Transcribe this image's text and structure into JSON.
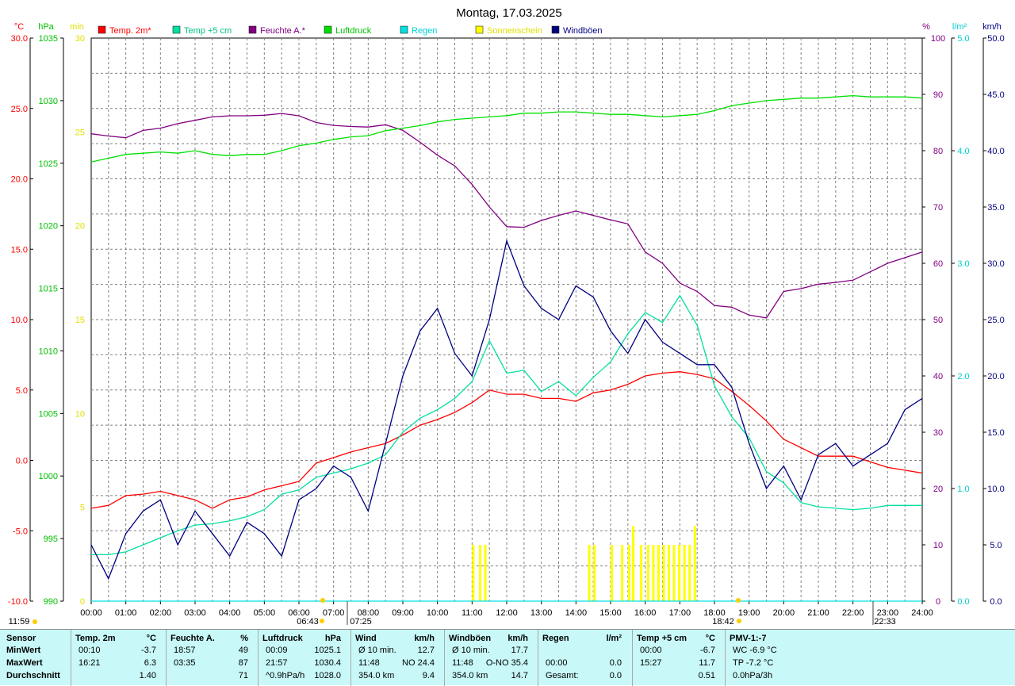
{
  "title": "Montag, 17.03.2025",
  "colors": {
    "temp2m": "#ff0000",
    "temp5cm": "#00e0a0",
    "humidity": "#800080",
    "pressure": "#00e000",
    "rain": "#00e0e0",
    "sun": "#ffff00",
    "gusts": "#000080",
    "grid": "#808080"
  },
  "axes_headers": {
    "temp_unit": "°C",
    "pressure_unit": "hPa",
    "sun_unit": "min",
    "humidity_unit": "%",
    "rain_unit": "l/m²",
    "wind_unit": "km/h"
  },
  "legend": [
    "Temp. 2m*",
    "Temp +5 cm",
    "Feuchte A.*",
    "Luftdruck",
    "Regen",
    "Sonnenschein",
    "Windböen"
  ],
  "sun_times": {
    "sunrise": "06:43",
    "sunset": "18:42",
    "moonrise": "07:25",
    "moonset": "22:33",
    "daylength": "11:59"
  },
  "chart_data": {
    "type": "line",
    "title": "Montag, 17.03.2025",
    "x_ticks": [
      "00:00",
      "01:00",
      "02:00",
      "03:00",
      "04:00",
      "05:00",
      "06:00",
      "07:00",
      "08:00",
      "09:00",
      "10:00",
      "11:00",
      "12:00",
      "13:00",
      "14:00",
      "15:00",
      "16:00",
      "17:00",
      "18:00",
      "19:00",
      "20:00",
      "21:00",
      "22:00",
      "23:00",
      "24:00"
    ],
    "x_range_hours": [
      0,
      24
    ],
    "temp_axis": {
      "min": -10,
      "max": 30,
      "ticks": [
        "-10.0",
        "-5.0",
        "0.0",
        "5.0",
        "10.0",
        "15.0",
        "20.0",
        "25.0",
        "30.0"
      ]
    },
    "pressure_axis": {
      "min": 990,
      "max": 1035,
      "ticks": [
        "990",
        "995",
        "1000",
        "1005",
        "1010",
        "1015",
        "1020",
        "1025",
        "1030",
        "1035"
      ]
    },
    "sun_axis": {
      "min": 0,
      "max": 30,
      "ticks": [
        "0",
        "5",
        "10",
        "15",
        "20",
        "25",
        "30"
      ]
    },
    "humidity_axis": {
      "min": 0,
      "max": 100,
      "ticks": [
        "0",
        "10",
        "20",
        "30",
        "40",
        "50",
        "60",
        "70",
        "80",
        "90",
        "100"
      ]
    },
    "rain_axis": {
      "min": 0,
      "max": 5,
      "ticks": [
        "0.0",
        "1.0",
        "2.0",
        "3.0",
        "4.0",
        "5.0"
      ]
    },
    "wind_axis": {
      "min": 0,
      "max": 50,
      "ticks": [
        "0.0",
        "5.0",
        "10.0",
        "15.0",
        "20.0",
        "25.0",
        "30.0",
        "35.0",
        "40.0",
        "45.0",
        "50.0"
      ]
    },
    "series": [
      {
        "name": "Temp. 2m*",
        "axis": "temp",
        "x": [
          0,
          0.5,
          1,
          1.5,
          2,
          2.5,
          3,
          3.5,
          4,
          4.5,
          5,
          5.5,
          6,
          6.5,
          7,
          7.5,
          8,
          8.5,
          9,
          9.5,
          10,
          10.5,
          11,
          11.5,
          12,
          12.5,
          13,
          13.5,
          14,
          14.5,
          15,
          15.5,
          16,
          16.5,
          17,
          17.5,
          18,
          18.5,
          19,
          19.5,
          20,
          20.5,
          21,
          21.5,
          22,
          22.5,
          23,
          23.5,
          24
        ],
        "y": [
          -3.4,
          -3.2,
          -2.5,
          -2.4,
          -2.2,
          -2.5,
          -2.8,
          -3.4,
          -2.8,
          -2.6,
          -2.1,
          -1.8,
          -1.5,
          -0.2,
          0.2,
          0.6,
          0.9,
          1.2,
          1.8,
          2.5,
          2.9,
          3.4,
          4.1,
          5.0,
          4.7,
          4.7,
          4.4,
          4.4,
          4.2,
          4.8,
          5.0,
          5.4,
          6.0,
          6.2,
          6.3,
          6.1,
          5.8,
          4.9,
          3.9,
          2.8,
          1.5,
          0.9,
          0.3,
          0.3,
          0.3,
          -0.1,
          -0.5,
          -0.7,
          -0.9
        ]
      },
      {
        "name": "Temp +5 cm",
        "axis": "temp",
        "x": [
          0,
          0.5,
          1,
          1.5,
          2,
          2.5,
          3,
          3.5,
          4,
          4.5,
          5,
          5.5,
          6,
          6.5,
          7,
          7.5,
          8,
          8.5,
          9,
          9.5,
          10,
          10.5,
          11,
          11.5,
          12,
          12.5,
          13,
          13.5,
          14,
          14.5,
          15,
          15.5,
          16,
          16.5,
          17,
          17.5,
          18,
          18.5,
          19,
          19.5,
          20,
          20.5,
          21,
          21.5,
          22,
          22.5,
          23,
          23.5,
          24
        ],
        "y": [
          -6.7,
          -6.7,
          -6.5,
          -6.0,
          -5.5,
          -5.0,
          -4.6,
          -4.5,
          -4.3,
          -4.0,
          -3.5,
          -2.4,
          -2.1,
          -1.2,
          -0.9,
          -0.6,
          -0.2,
          0.4,
          2.0,
          3.0,
          3.6,
          4.4,
          5.6,
          8.5,
          6.2,
          6.4,
          4.9,
          5.6,
          4.6,
          5.9,
          7.0,
          9.0,
          10.5,
          9.8,
          11.7,
          9.6,
          5.3,
          3.1,
          1.6,
          -0.8,
          -1.6,
          -3.0,
          -3.3,
          -3.4,
          -3.5,
          -3.4,
          -3.2,
          -3.2,
          -3.2
        ]
      },
      {
        "name": "Feuchte A.*",
        "axis": "humidity",
        "x": [
          0,
          0.5,
          1,
          1.5,
          2,
          2.5,
          3,
          3.5,
          4,
          4.5,
          5,
          5.5,
          6,
          6.5,
          7,
          7.5,
          8,
          8.5,
          9,
          9.5,
          10,
          10.5,
          11,
          11.5,
          12,
          12.5,
          13,
          13.5,
          14,
          14.5,
          15,
          15.5,
          16,
          16.5,
          17,
          17.5,
          18,
          18.5,
          19,
          19.5,
          20,
          20.5,
          21,
          21.5,
          22,
          22.5,
          23,
          23.5,
          24
        ],
        "y": [
          83,
          82.6,
          82.3,
          83.6,
          84,
          84.8,
          85.4,
          86,
          86.2,
          86.2,
          86.3,
          86.6,
          86.2,
          85,
          84.5,
          84.3,
          84.2,
          84.6,
          83.6,
          81.5,
          79.2,
          77.3,
          74,
          70,
          66.5,
          66.4,
          67.6,
          68.5,
          69.3,
          68.5,
          67.7,
          67,
          62,
          60,
          56.5,
          55,
          52.5,
          52.2,
          50.8,
          50.3,
          55,
          55.5,
          56.3,
          56.6,
          57,
          58.5,
          60,
          61,
          62
        ]
      },
      {
        "name": "Luftdruck",
        "axis": "pressure",
        "x": [
          0,
          0.5,
          1,
          1.5,
          2,
          2.5,
          3,
          3.5,
          4,
          4.5,
          5,
          5.5,
          6,
          6.5,
          7,
          7.5,
          8,
          8.5,
          9,
          9.5,
          10,
          10.5,
          11,
          11.5,
          12,
          12.5,
          13,
          13.5,
          14,
          14.5,
          15,
          15.5,
          16,
          16.5,
          17,
          17.5,
          18,
          18.5,
          19,
          19.5,
          20,
          20.5,
          21,
          21.5,
          22,
          22.5,
          23,
          23.5,
          24
        ],
        "y": [
          1025.1,
          1025.4,
          1025.7,
          1025.8,
          1025.9,
          1025.8,
          1026,
          1025.7,
          1025.6,
          1025.7,
          1025.7,
          1026,
          1026.4,
          1026.6,
          1026.9,
          1027.1,
          1027.2,
          1027.6,
          1027.8,
          1028,
          1028.3,
          1028.5,
          1028.6,
          1028.7,
          1028.8,
          1029,
          1029,
          1029.1,
          1029.1,
          1029,
          1028.9,
          1028.9,
          1028.8,
          1028.7,
          1028.8,
          1028.9,
          1029.2,
          1029.6,
          1029.8,
          1030,
          1030.1,
          1030.2,
          1030.2,
          1030.3,
          1030.4,
          1030.3,
          1030.3,
          1030.3,
          1030.2
        ]
      },
      {
        "name": "Windböen",
        "axis": "wind",
        "x": [
          0,
          0.5,
          1,
          1.5,
          2,
          2.5,
          3,
          3.5,
          4,
          4.5,
          5,
          5.5,
          6,
          6.5,
          7,
          7.5,
          8,
          8.5,
          9,
          9.5,
          10,
          10.5,
          11,
          11.5,
          12,
          12.5,
          13,
          13.5,
          14,
          14.5,
          15,
          15.5,
          16,
          16.5,
          17,
          17.5,
          18,
          18.5,
          19,
          19.5,
          20,
          20.5,
          21,
          21.5,
          22,
          22.5,
          23,
          23.5,
          24
        ],
        "y": [
          5,
          2,
          6,
          8,
          9,
          5,
          8,
          6,
          4,
          7,
          6,
          4,
          9,
          10,
          12,
          11,
          8,
          14,
          20,
          24,
          26,
          22,
          20,
          25,
          32,
          28,
          26,
          25,
          28,
          27,
          24,
          22,
          25,
          23,
          22,
          21,
          21,
          19,
          14,
          10,
          12,
          9,
          13,
          14,
          12,
          13,
          14,
          17,
          18
        ]
      },
      {
        "name": "Regen",
        "axis": "rain",
        "x": [
          0,
          24
        ],
        "y": [
          0,
          0
        ]
      }
    ],
    "sunshine_bars": [
      {
        "x": 11.0,
        "y": 3
      },
      {
        "x": 11.2,
        "y": 3
      },
      {
        "x": 11.35,
        "y": 3
      },
      {
        "x": 14.35,
        "y": 3
      },
      {
        "x": 14.5,
        "y": 3
      },
      {
        "x": 15.0,
        "y": 3
      },
      {
        "x": 15.3,
        "y": 3
      },
      {
        "x": 15.5,
        "y": 3
      },
      {
        "x": 15.62,
        "y": 4
      },
      {
        "x": 15.85,
        "y": 3
      },
      {
        "x": 16.05,
        "y": 3
      },
      {
        "x": 16.2,
        "y": 3
      },
      {
        "x": 16.35,
        "y": 3
      },
      {
        "x": 16.5,
        "y": 3
      },
      {
        "x": 16.65,
        "y": 3
      },
      {
        "x": 16.8,
        "y": 3
      },
      {
        "x": 16.95,
        "y": 3
      },
      {
        "x": 17.1,
        "y": 3
      },
      {
        "x": 17.25,
        "y": 3
      },
      {
        "x": 17.4,
        "y": 4
      }
    ]
  },
  "stats_table": {
    "columns": [
      {
        "label": "Sensor",
        "unit": "",
        "min_time": "",
        "min_val": "",
        "max_time": "",
        "max_val": "",
        "avg_label": "",
        "avg_val": ""
      },
      {
        "label": "Temp. 2m",
        "unit": "°C",
        "min_time": "00:10",
        "min_val": "-3.7",
        "max_time": "16:21",
        "max_val": "6.3",
        "avg_label": "",
        "avg_val": "1.40"
      },
      {
        "label": "Feuchte A.",
        "unit": "%",
        "min_time": "18:57",
        "min_val": "49",
        "max_time": "03:35",
        "max_val": "87",
        "avg_label": "",
        "avg_val": "71"
      },
      {
        "label": "Luftdruck",
        "unit": "hPa",
        "min_time": "00:09",
        "min_val": "1025.1",
        "max_time": "21:57",
        "max_val": "1030.4",
        "avg_label": "^0.9hPa/h",
        "avg_val": "1028.0"
      },
      {
        "label": "Wind",
        "unit": "km/h",
        "min_time": "Ø 10 min.",
        "min_val": "12.7",
        "max_time": "11:48",
        "max_val": "NO 24.4",
        "avg_label": "354.0 km",
        "avg_val": "9.4"
      },
      {
        "label": "Windböen",
        "unit": "km/h",
        "min_time": "Ø 10 min.",
        "min_val": "17.7",
        "max_time": "11:48",
        "max_val": "O-NO 35.4",
        "avg_label": "354.0 km",
        "avg_val": "14.7"
      },
      {
        "label": "Regen",
        "unit": "l/m²",
        "min_time": "",
        "min_val": "",
        "max_time": "00:00",
        "max_val": "0.0",
        "avg_label": "Gesamt:",
        "avg_val": "0.0"
      },
      {
        "label": "Temp +5 cm",
        "unit": "°C",
        "min_time": "00:00",
        "min_val": "-6.7",
        "max_time": "15:27",
        "max_val": "11.7",
        "avg_label": "",
        "avg_val": "0.51"
      },
      {
        "label": "PMV-1:-7",
        "unit": "",
        "min_time": "WC -6.9 °C",
        "min_val": "",
        "max_time": "TP -7.2 °C",
        "max_val": "",
        "avg_label": "0.0hPa/3h",
        "avg_val": ""
      }
    ],
    "row_labels": [
      "MinWert",
      "MaxWert",
      "Durchschnitt"
    ]
  }
}
